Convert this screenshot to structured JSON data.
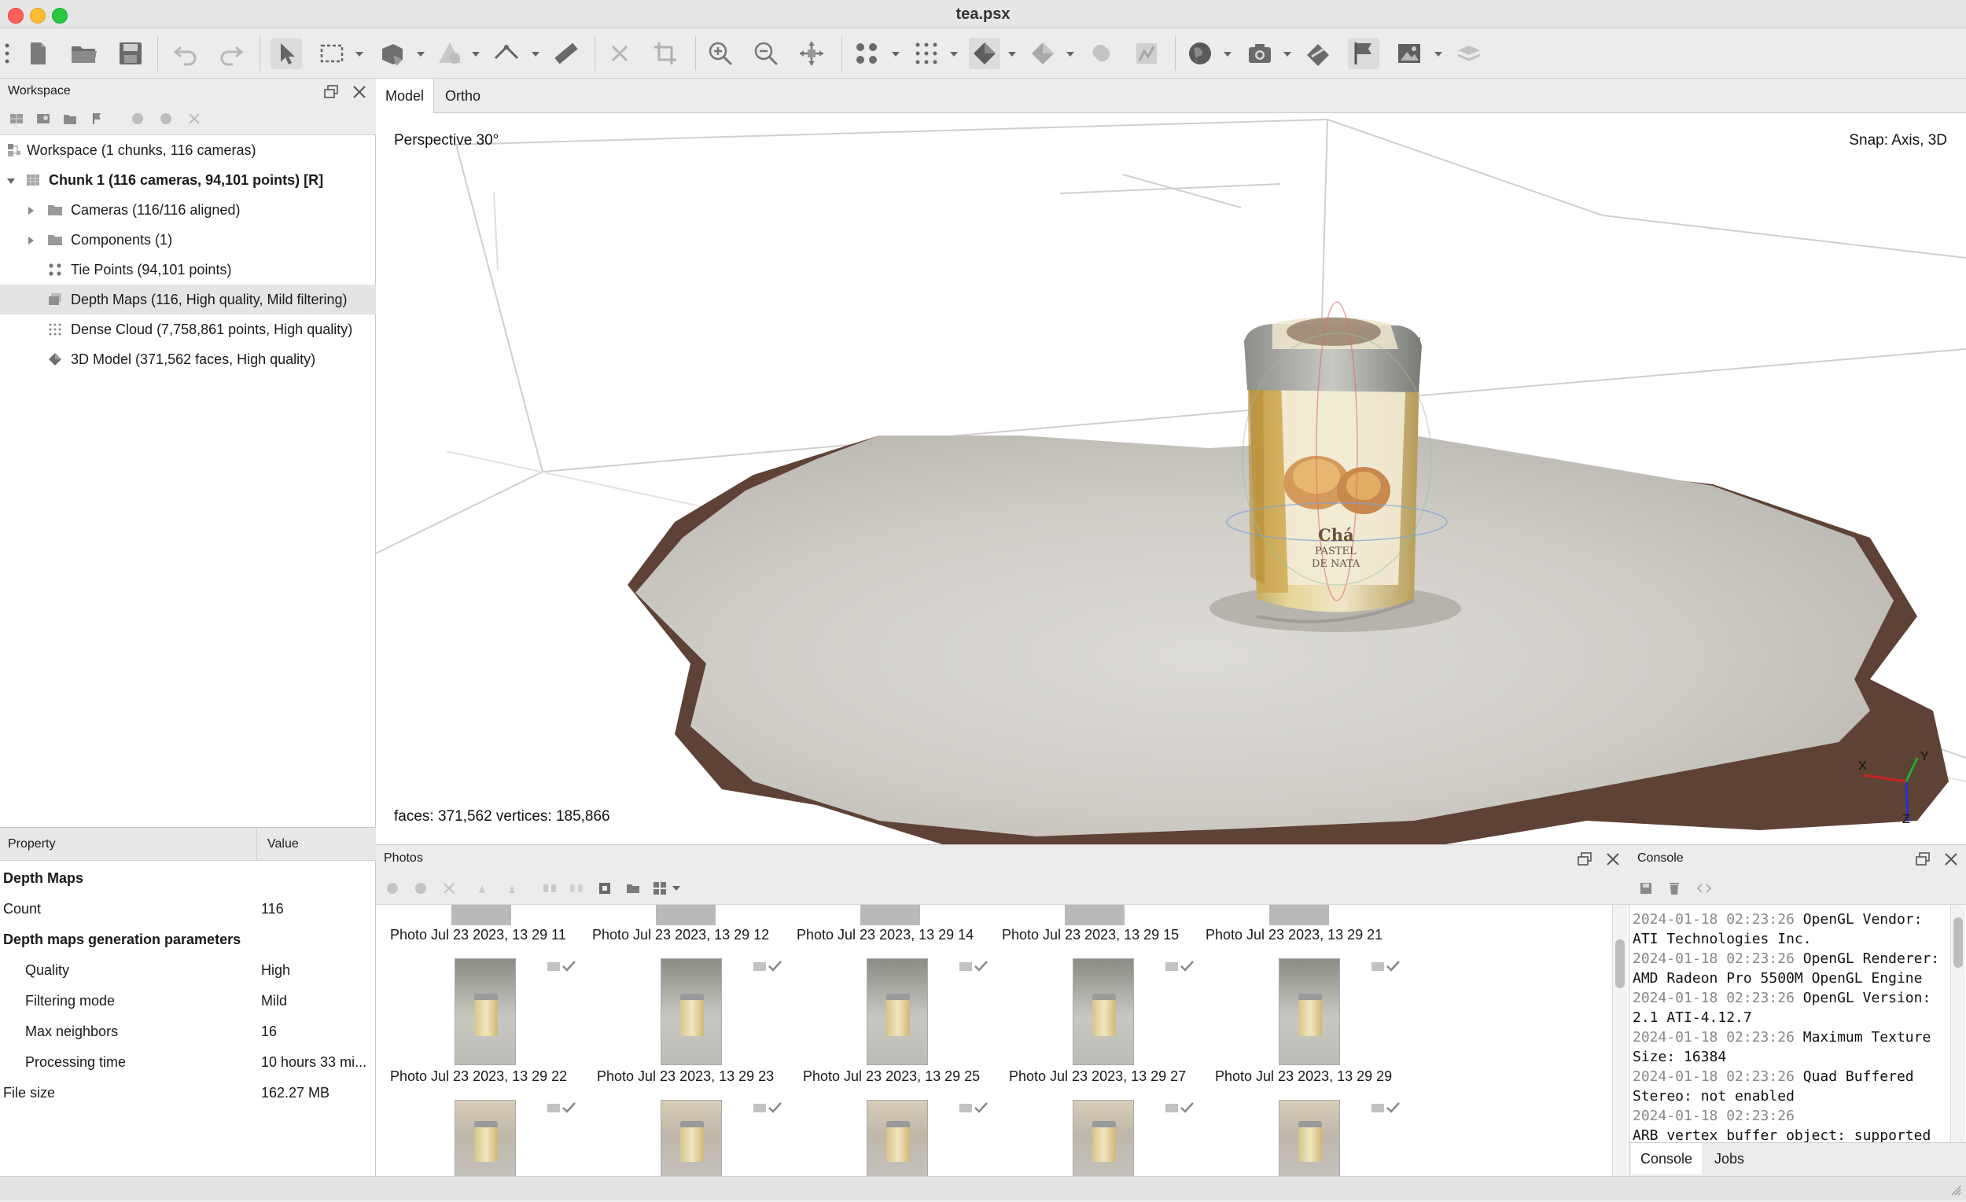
{
  "window": {
    "title": "tea.psx"
  },
  "workspace": {
    "title": "Workspace",
    "tree": [
      {
        "label": "Workspace (1 chunks, 116 cameras)",
        "level": 0,
        "icon": "workspace-icon"
      },
      {
        "label": "Chunk 1 (116 cameras, 94,101 points) [R]",
        "level": 1,
        "icon": "chunk-icon",
        "bold": true,
        "expanded": true
      },
      {
        "label": "Cameras (116/116 aligned)",
        "level": 2,
        "icon": "folder-icon",
        "expandable": true
      },
      {
        "label": "Components (1)",
        "level": 2,
        "icon": "folder-icon",
        "expandable": true
      },
      {
        "label": "Tie Points (94,101 points)",
        "level": 2,
        "icon": "tie-points-icon"
      },
      {
        "label": "Depth Maps (116, High quality, Mild filtering)",
        "level": 2,
        "icon": "depth-maps-icon",
        "selected": true
      },
      {
        "label": "Dense Cloud (7,758,861 points, High quality)",
        "level": 2,
        "icon": "dense-cloud-icon"
      },
      {
        "label": "3D Model (371,562 faces, High quality)",
        "level": 2,
        "icon": "model-icon"
      }
    ]
  },
  "properties": {
    "col_property": "Property",
    "col_value": "Value",
    "rows": [
      {
        "key": "Depth Maps",
        "value": "",
        "bold": true,
        "indent": 0
      },
      {
        "key": "Count",
        "value": "116",
        "bold": false,
        "indent": 0
      },
      {
        "key": "Depth maps generation parameters",
        "value": "",
        "bold": true,
        "indent": 0
      },
      {
        "key": "Quality",
        "value": "High",
        "bold": false,
        "indent": 1
      },
      {
        "key": "Filtering mode",
        "value": "Mild",
        "bold": false,
        "indent": 1
      },
      {
        "key": "Max neighbors",
        "value": "16",
        "bold": false,
        "indent": 1
      },
      {
        "key": "Processing time",
        "value": "10 hours 33 mi...",
        "bold": false,
        "indent": 1
      },
      {
        "key": "File size",
        "value": "162.27 MB",
        "bold": false,
        "indent": 0
      }
    ]
  },
  "viewport": {
    "tabs": [
      {
        "label": "Model",
        "active": true
      },
      {
        "label": "Ortho",
        "active": false
      }
    ],
    "projection": "Perspective 30°",
    "snap": "Snap: Axis, 3D",
    "stats": "faces: 371,562 vertices: 185,866",
    "axis_labels": {
      "x": "X",
      "y": "Y",
      "z": "Z"
    },
    "product_text": {
      "brand": "Chá",
      "line1": "PASTEL",
      "line2": "DE NATA"
    }
  },
  "photos": {
    "title": "Photos",
    "row1_labels": [
      "Photo Jul 23 2023, 13 29 11",
      "Photo Jul 23 2023, 13 29 12",
      "Photo Jul 23 2023, 13 29 14",
      "Photo Jul 23 2023, 13 29 15",
      "Photo Jul 23 2023, 13 29 21"
    ],
    "row2_labels": [
      "Photo Jul 23 2023, 13 29 22",
      "Photo Jul 23 2023, 13 29 23",
      "Photo Jul 23 2023, 13 29 25",
      "Photo Jul 23 2023, 13 29 27",
      "Photo Jul 23 2023, 13 29 29"
    ]
  },
  "console": {
    "title": "Console",
    "log": [
      {
        "ts": "2024-01-18 02:23:26",
        "msg": "OpenGL Vendor:",
        "cont": "ATI Technologies Inc."
      },
      {
        "ts": "2024-01-18 02:23:26",
        "msg": "OpenGL Renderer:",
        "cont": "AMD Radeon Pro 5500M OpenGL Engine"
      },
      {
        "ts": "2024-01-18 02:23:26",
        "msg": "OpenGL Version:",
        "cont": "2.1 ATI-4.12.7"
      },
      {
        "ts": "2024-01-18 02:23:26",
        "msg": "Maximum Texture",
        "cont": "Size: 16384"
      },
      {
        "ts": "2024-01-18 02:23:26",
        "msg": "Quad Buffered",
        "cont": "Stereo: not enabled"
      },
      {
        "ts": "2024-01-18 02:23:26",
        "msg": "",
        "cont": "ARB_vertex_buffer_object: supported"
      }
    ],
    "tabs": [
      {
        "label": "Console",
        "active": true
      },
      {
        "label": "Jobs",
        "active": false
      }
    ]
  }
}
